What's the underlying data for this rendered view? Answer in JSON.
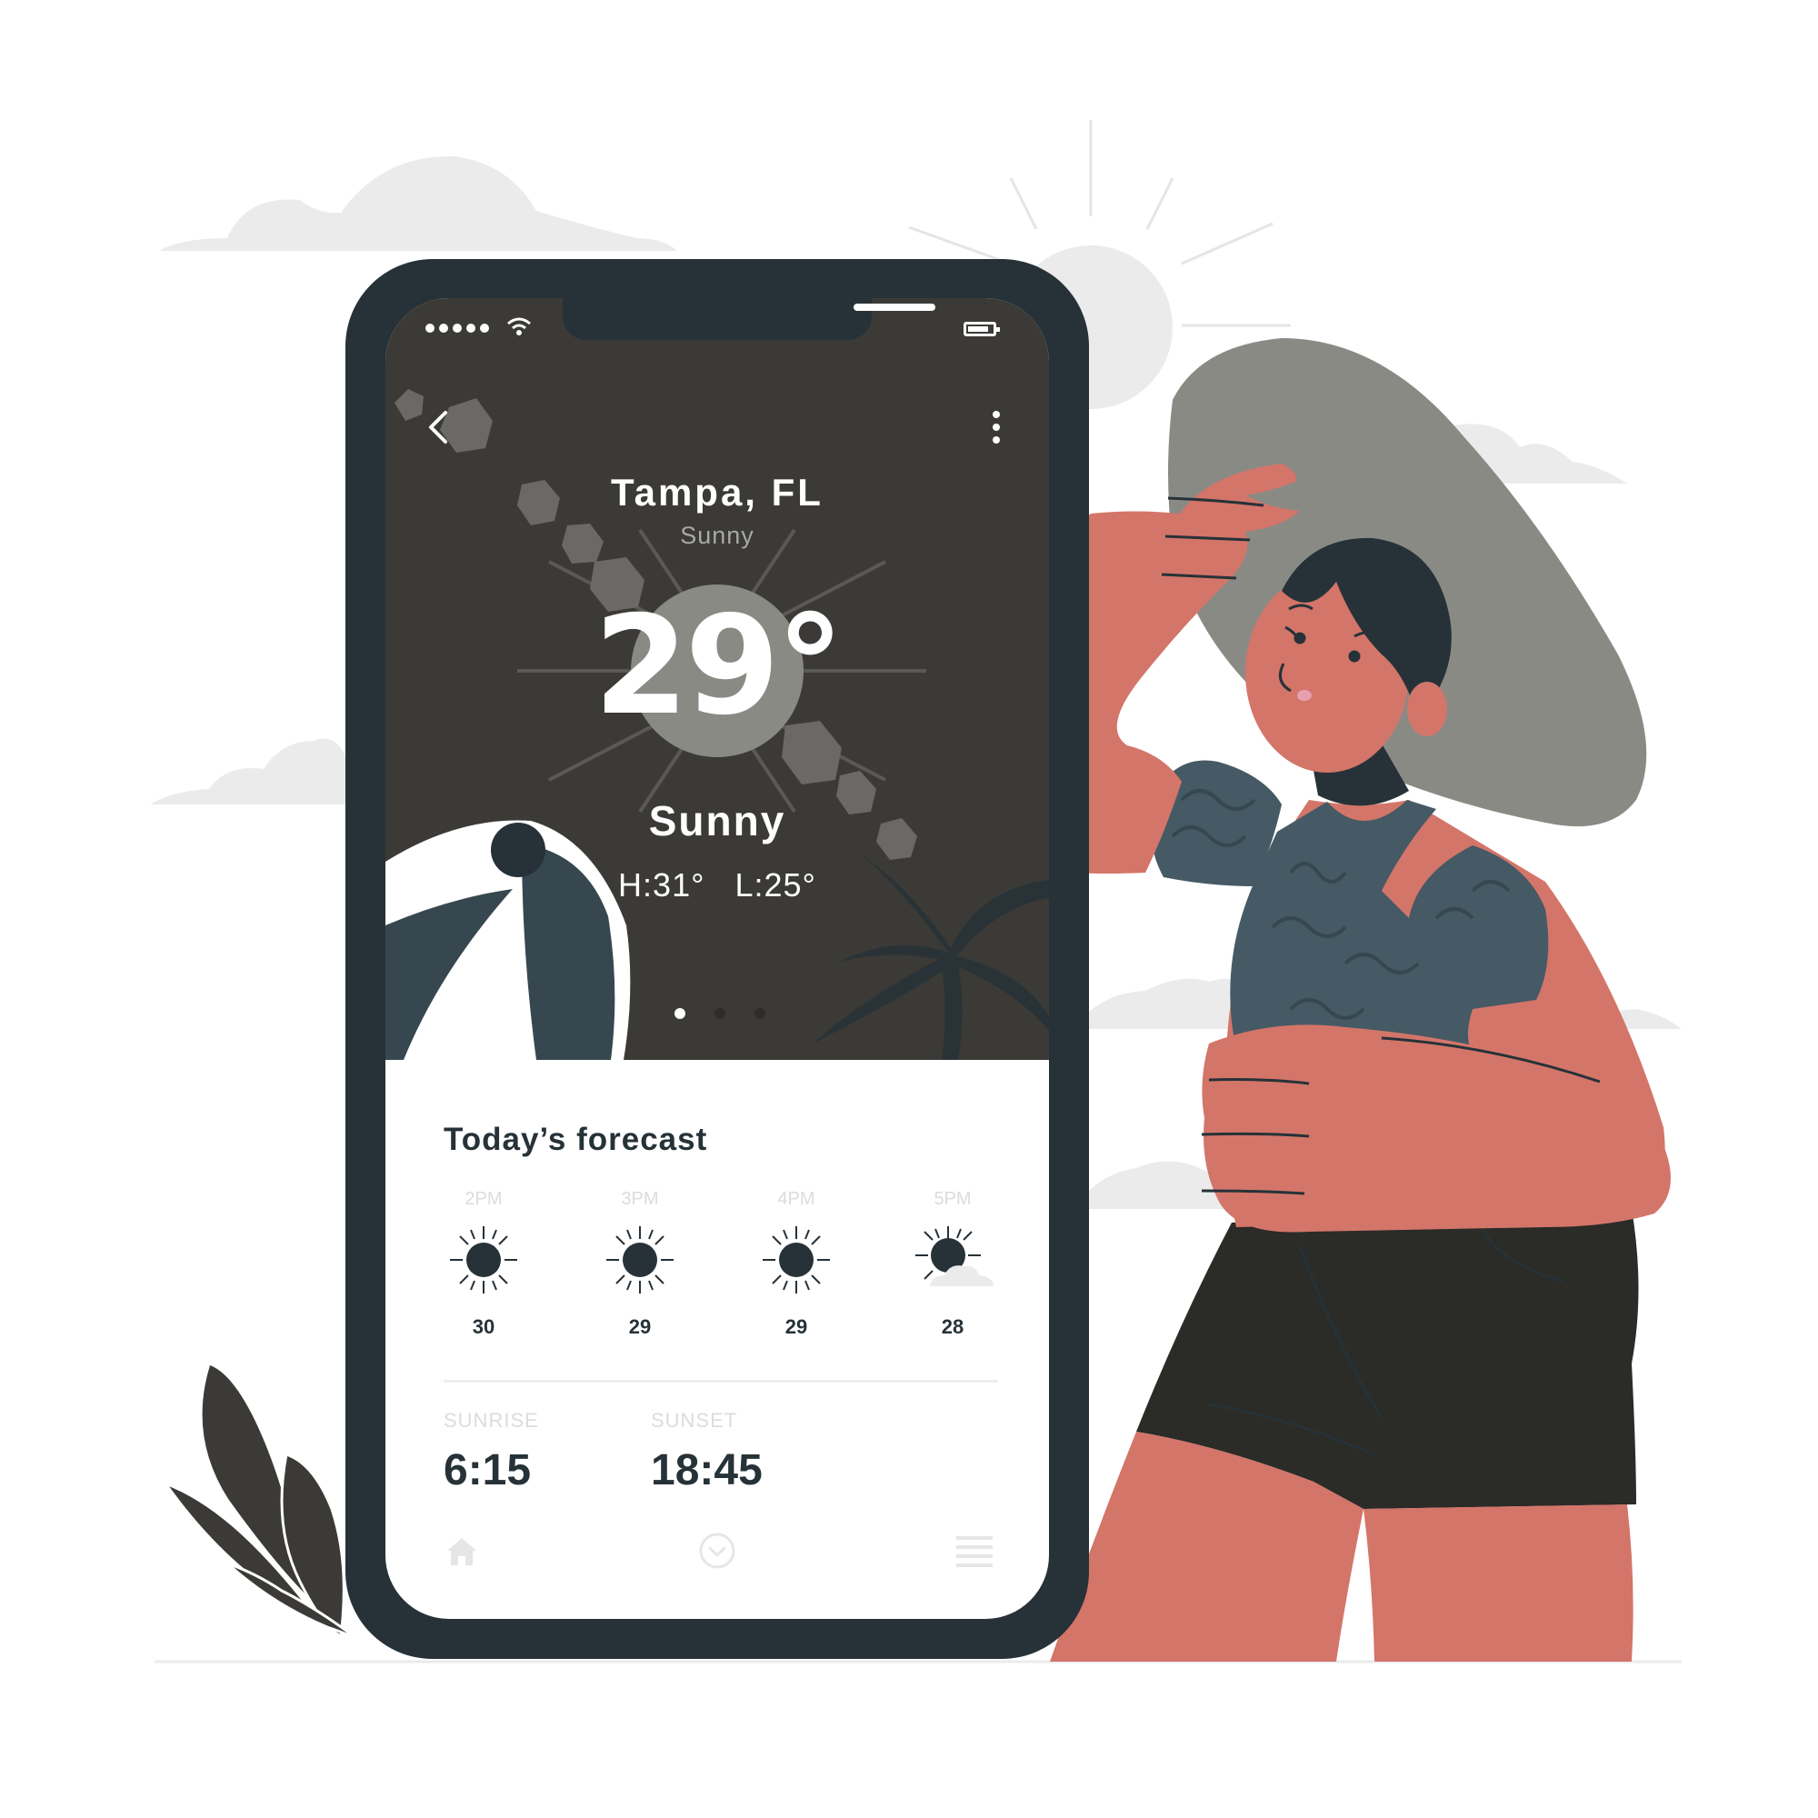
{
  "colors": {
    "phone_frame": "#263238",
    "screen_dark": "#3b3a36",
    "skin": "#d4756a",
    "hat": "#8a8a85",
    "shirt": "#455a64",
    "shorts": "#2b2b27",
    "cloud": "#ebebeb"
  },
  "status_bar": {
    "signal_icon": "signal-dots-icon",
    "wifi_icon": "wifi-icon",
    "battery_icon": "battery-icon"
  },
  "header": {
    "back_icon": "chevron-left-icon",
    "menu_icon": "more-vertical-icon"
  },
  "weather": {
    "city": "Tampa, FL",
    "subtitle": "Sunny",
    "temperature": "29°",
    "condition": "Sunny",
    "high_low": "H:31° L:25°"
  },
  "pagination": {
    "count": 3,
    "active": 1
  },
  "forecast": {
    "title": "Today’s forecast",
    "hours": [
      {
        "time": "2PM",
        "temp": "30",
        "icon": "sun-icon"
      },
      {
        "time": "3PM",
        "temp": "29",
        "icon": "sun-icon"
      },
      {
        "time": "4PM",
        "temp": "29",
        "icon": "sun-icon"
      },
      {
        "time": "5PM",
        "temp": "28",
        "icon": "partly-cloudy-icon"
      }
    ]
  },
  "sun": {
    "sunrise_label": "SUNRISE",
    "sunrise_time": "6:15",
    "sunset_label": "SUNSET",
    "sunset_time": "18:45"
  },
  "bottom_nav": {
    "home_icon": "home-icon",
    "center_icon": "chevron-down-circle-icon",
    "menu_icon": "hamburger-menu-icon"
  }
}
